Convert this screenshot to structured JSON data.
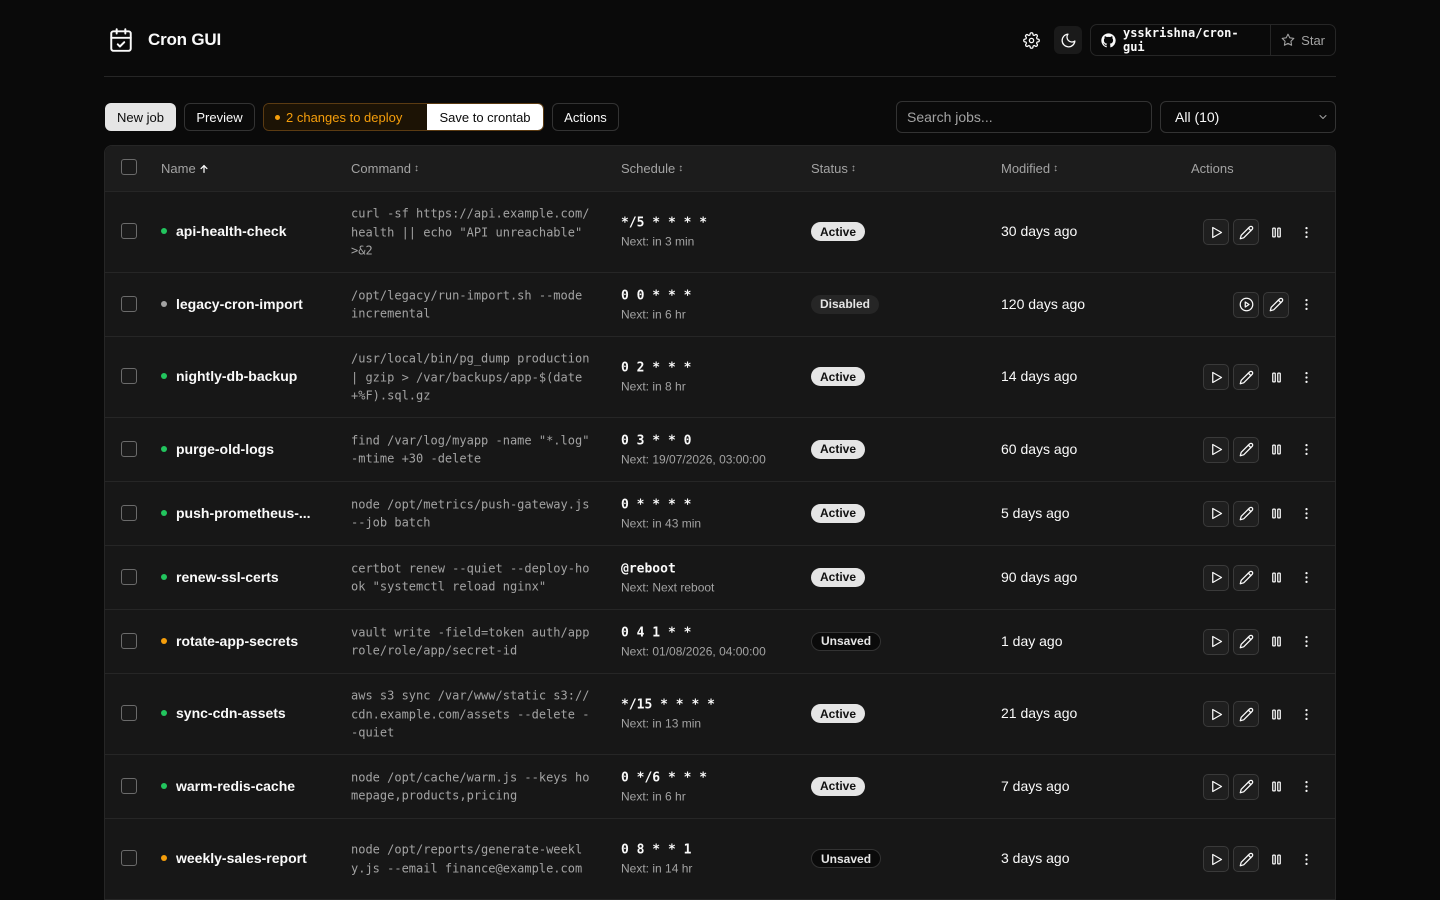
{
  "header": {
    "title": "Cron GUI",
    "repo": "ysskrishna/cron-gui",
    "star_label": "Star"
  },
  "toolbar": {
    "new_job": "New job",
    "preview": "Preview",
    "changes": "2 changes to deploy",
    "save": "Save to crontab",
    "actions": "Actions",
    "search_placeholder": "Search jobs...",
    "filter": "All (10)"
  },
  "table": {
    "columns": {
      "name": "Name",
      "command": "Command",
      "schedule": "Schedule",
      "status": "Status",
      "modified": "Modified",
      "actions": "Actions"
    },
    "rows": [
      {
        "name": "api-health-check",
        "dot": "green",
        "command": "curl -sf https://api.example.com/health || echo \"API unreachable\" >&2",
        "schedule": "*/5 * * * *",
        "next": "Next: in 3 min",
        "status": "Active",
        "status_kind": "active",
        "modified": "30 days ago",
        "actions": "full"
      },
      {
        "name": "legacy-cron-import",
        "dot": "gray",
        "command": "/opt/legacy/run-import.sh --mode incremental",
        "schedule": "0 0 * * *",
        "next": "Next: in 6 hr",
        "status": "Disabled",
        "status_kind": "disabled",
        "modified": "120 days ago",
        "actions": "disabled"
      },
      {
        "name": "nightly-db-backup",
        "dot": "green",
        "command": "/usr/local/bin/pg_dump production | gzip > /var/backups/app-$(date +%F).sql.gz",
        "schedule": "0 2 * * *",
        "next": "Next: in 8 hr",
        "status": "Active",
        "status_kind": "active",
        "modified": "14 days ago",
        "actions": "full"
      },
      {
        "name": "purge-old-logs",
        "dot": "green",
        "command": "find /var/log/myapp -name \"*.log\" -mtime +30 -delete",
        "schedule": "0 3 * * 0",
        "next": "Next: 19/07/2026, 03:00:00",
        "status": "Active",
        "status_kind": "active",
        "modified": "60 days ago",
        "actions": "full"
      },
      {
        "name": "push-prometheus-...",
        "dot": "green",
        "command": "node /opt/metrics/push-gateway.js --job batch",
        "schedule": "0 * * * *",
        "next": "Next: in 43 min",
        "status": "Active",
        "status_kind": "active",
        "modified": "5 days ago",
        "actions": "full"
      },
      {
        "name": "renew-ssl-certs",
        "dot": "green",
        "command": "certbot renew --quiet --deploy-hook \"systemctl reload nginx\"",
        "schedule": "@reboot",
        "next": "Next: Next reboot",
        "status": "Active",
        "status_kind": "active",
        "modified": "90 days ago",
        "actions": "full"
      },
      {
        "name": "rotate-app-secrets",
        "dot": "orange",
        "command": "vault write -field=token auth/approle/role/app/secret-id",
        "schedule": "0 4 1 * *",
        "next": "Next: 01/08/2026, 04:00:00",
        "status": "Unsaved",
        "status_kind": "unsaved",
        "modified": "1 day ago",
        "actions": "full"
      },
      {
        "name": "sync-cdn-assets",
        "dot": "green",
        "command": "aws s3 sync /var/www/static s3://cdn.example.com/assets --delete --quiet",
        "schedule": "*/15 * * * *",
        "next": "Next: in 13 min",
        "status": "Active",
        "status_kind": "active",
        "modified": "21 days ago",
        "actions": "full"
      },
      {
        "name": "warm-redis-cache",
        "dot": "green",
        "command": "node /opt/cache/warm.js --keys homepage,products,pricing",
        "schedule": "0 */6 * * *",
        "next": "Next: in 6 hr",
        "status": "Active",
        "status_kind": "active",
        "modified": "7 days ago",
        "actions": "full"
      },
      {
        "name": "weekly-sales-report",
        "dot": "orange",
        "command": "node /opt/reports/generate-weekly.js --email finance@example.com",
        "schedule": "0 8 * * 1",
        "next": "Next: in 14 hr",
        "status": "Unsaved",
        "status_kind": "unsaved",
        "modified": "3 days ago",
        "actions": "full"
      }
    ]
  },
  "colors": {
    "dot_green": "#22c55e",
    "dot_gray": "#a3a3a3",
    "dot_orange": "#f59e0b",
    "deploy_accent": "#f59e0b"
  },
  "icons": {
    "logo": "calendar-check-icon",
    "settings": "gear-icon",
    "theme": "moon-icon",
    "github": "github-icon",
    "star": "star-icon"
  }
}
